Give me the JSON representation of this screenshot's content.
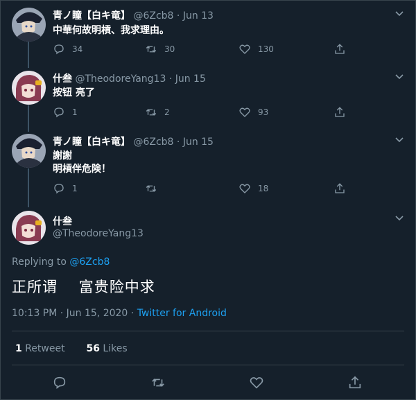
{
  "tweets": [
    {
      "name": "青ノ瞳【白キ竜】",
      "handle": "@6Zcb8",
      "date": "Jun 13",
      "text": "中華何故明槓、我求理由。",
      "replies": "34",
      "retweets": "30",
      "likes": "130"
    },
    {
      "name": "什叁",
      "handle": "@TheodoreYang13",
      "date": "Jun 15",
      "text": "按钮 亮了",
      "replies": "1",
      "retweets": "2",
      "likes": "93"
    },
    {
      "name": "青ノ瞳【白キ竜】",
      "handle": "@6Zcb8",
      "date": "Jun 15",
      "text_line1": "謝謝",
      "text_line2": "明槓伴危険！",
      "replies": "1",
      "retweets": "",
      "likes": "18"
    }
  ],
  "main": {
    "name": "什叁",
    "handle": "@TheodoreYang13",
    "replying_prefix": "Replying to",
    "replying_to": "@6Zcb8",
    "text": "正所谓    富贵险中求",
    "time": "10:13 PM · Jun 15, 2020 · ",
    "source": "Twitter for Android",
    "retweet_count": "1",
    "retweet_label": "Retweet",
    "like_count": "56",
    "like_label": "Likes"
  },
  "colors": {
    "background": "#15202b",
    "accent": "#1da1f2",
    "muted": "#8899a6",
    "border": "#38444d"
  }
}
